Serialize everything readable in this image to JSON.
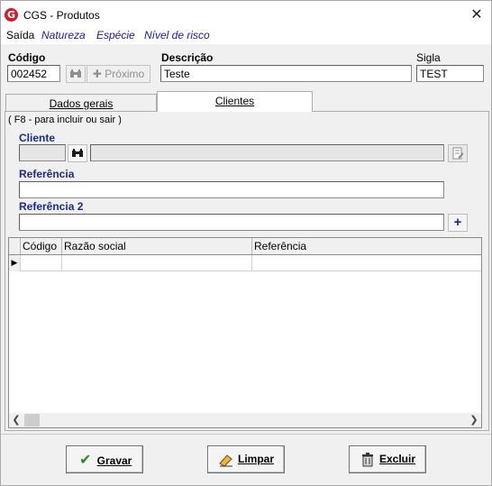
{
  "window": {
    "title": "CGS - Produtos",
    "close": "✕",
    "app_icon": "G"
  },
  "menu": {
    "saida": "Saída",
    "natureza": "Natureza",
    "especie": "Espécie",
    "nivel_risco": "Nível de risco"
  },
  "header": {
    "codigo_label": "Código",
    "codigo_value": "002452",
    "search_icon": "binoculars-icon",
    "proximo_label": "Próximo",
    "descricao_label": "Descrição",
    "descricao_value": "Teste",
    "sigla_label": "Sigla",
    "sigla_value": "TEST"
  },
  "tabs": [
    {
      "label": "Dados gerais"
    },
    {
      "label": "Clientes"
    }
  ],
  "clientes": {
    "hint": "( F8 - para incluir ou sair )",
    "cliente_label": "Cliente",
    "referencia_label": "Referência",
    "referencia2_label": "Referência 2",
    "add_icon": "+",
    "grid": {
      "columns": [
        "Código",
        "Razão social",
        "Referência"
      ],
      "row_marker": "▶"
    }
  },
  "actions": {
    "gravar": "Gravar",
    "limpar": "Limpar",
    "excluir": "Excluir"
  },
  "colors": {
    "accent_blue": "#1b2a8c",
    "app_red": "#cc1e2c"
  }
}
